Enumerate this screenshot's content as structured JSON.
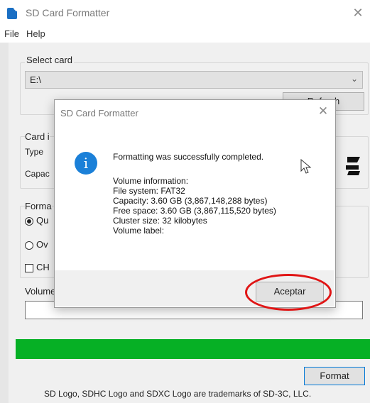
{
  "window": {
    "title": "SD Card Formatter"
  },
  "menu": {
    "file": "File",
    "help": "Help"
  },
  "select_card": {
    "label": "Select card",
    "value": "E:\\",
    "refresh_label": "Refresh",
    "refresh_visible": "Refresh"
  },
  "card_info": {
    "label_partial": "Card i",
    "type_partial": "Type",
    "capacity_partial": "Capac"
  },
  "format_options": {
    "label_partial": "Forma",
    "quick_partial": "Qu",
    "overwrite_partial": "Ov",
    "chs_partial": "CH"
  },
  "volume_label": {
    "label_partial": "Volume",
    "value": ""
  },
  "progress": {
    "percent": 100,
    "color": "#06b025"
  },
  "format_button": "Format",
  "footer_text": "SD Logo, SDHC Logo and SDXC Logo are trademarks of SD-3C, LLC.",
  "dialog": {
    "title": "SD Card Formatter",
    "message": "Formatting was successfully completed.",
    "volume_information": "Volume information:",
    "file_system": "File system: FAT32",
    "capacity": "Capacity: 3.60 GB (3,867,148,288 bytes)",
    "free_space": "Free space: 3.60 GB (3,867,115,520 bytes)",
    "cluster_size": "Cluster size: 32 kilobytes",
    "volume_label": "Volume label:",
    "accept_label": "Aceptar",
    "icon": "info-icon"
  },
  "annotation": {
    "highlight_color": "#e01515"
  }
}
